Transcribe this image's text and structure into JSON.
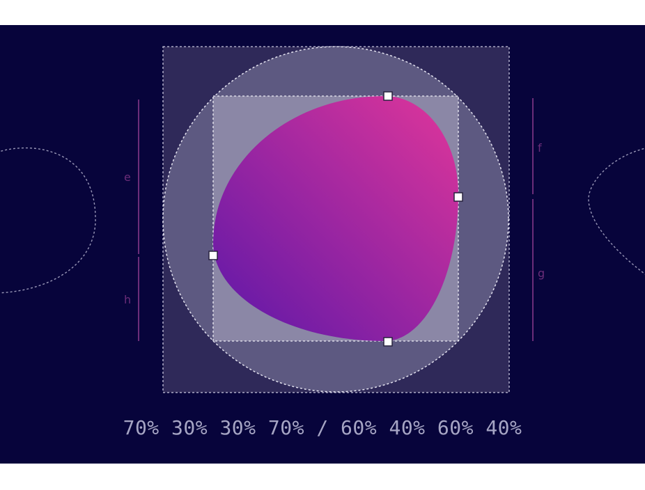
{
  "labels": {
    "e": "e",
    "f": "f",
    "g": "g",
    "h": "h"
  },
  "border_radius_value": "70% 30% 30% 70% / 60% 40% 60% 40%",
  "colors": {
    "background": "#07043b",
    "outer_box": "#2f2959",
    "circle": "#5d5981",
    "inner_box": "#8b87a6",
    "blob_start": "#5b17a8",
    "blob_end": "#e0369a",
    "guide": "#6b2d79"
  }
}
